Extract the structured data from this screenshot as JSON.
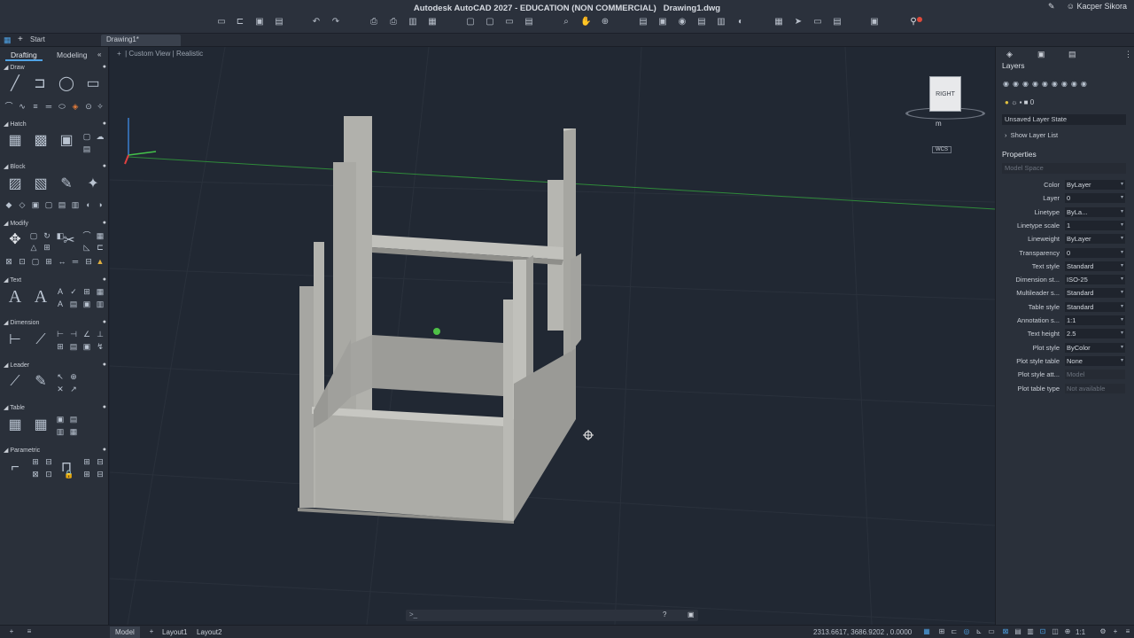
{
  "app": {
    "title": "Autodesk AutoCAD 2027 - EDUCATION (NON COMMERCIAL)",
    "file": "Drawing1.dwg",
    "user": "Kacper Sikora"
  },
  "tabs": {
    "start": "Start",
    "document": "Drawing1*"
  },
  "left_panel": {
    "tab_drafting": "Drafting",
    "tab_modeling": "Modeling",
    "sections": [
      "Draw",
      "Hatch",
      "Block",
      "Modify",
      "Text",
      "Dimension",
      "Leader",
      "Table",
      "Parametric"
    ]
  },
  "viewport": {
    "view_name": "Custom View",
    "visual_style": "Realistic",
    "viewcube_face": "RIGHT",
    "viewcube_bottom": "m",
    "wcs": "WCS"
  },
  "right_panel": {
    "layers_title": "Layers",
    "current_layer": "0",
    "layer_state": "Unsaved Layer State",
    "show_layer_list": "Show Layer List",
    "properties_title": "Properties",
    "model_space": "Model Space",
    "properties": [
      {
        "label": "Color",
        "value": "ByLayer"
      },
      {
        "label": "Layer",
        "value": "0"
      },
      {
        "label": "Linetype",
        "value": "ByLa..."
      },
      {
        "label": "Linetype scale",
        "value": "1"
      },
      {
        "label": "Lineweight",
        "value": "ByLayer"
      },
      {
        "label": "Transparency",
        "value": "0"
      },
      {
        "label": "Text style",
        "value": "Standard"
      },
      {
        "label": "Dimension st...",
        "value": "ISO-25"
      },
      {
        "label": "Multileader s...",
        "value": "Standard"
      },
      {
        "label": "Table style",
        "value": "Standard"
      },
      {
        "label": "Annotation s...",
        "value": "1:1"
      },
      {
        "label": "Text height",
        "value": "2.5"
      },
      {
        "label": "Plot style",
        "value": "ByColor"
      },
      {
        "label": "Plot style table",
        "value": "None"
      },
      {
        "label": "Plot style att...",
        "value": "Model"
      },
      {
        "label": "Plot table type",
        "value": "Not available"
      }
    ]
  },
  "status": {
    "model_tab": "Model",
    "layout1": "Layout1",
    "layout2": "Layout2",
    "coordinates": "2313.6617, 3686.9202 , 0.0000",
    "scale": "1:1"
  },
  "command_prompt": ">_"
}
